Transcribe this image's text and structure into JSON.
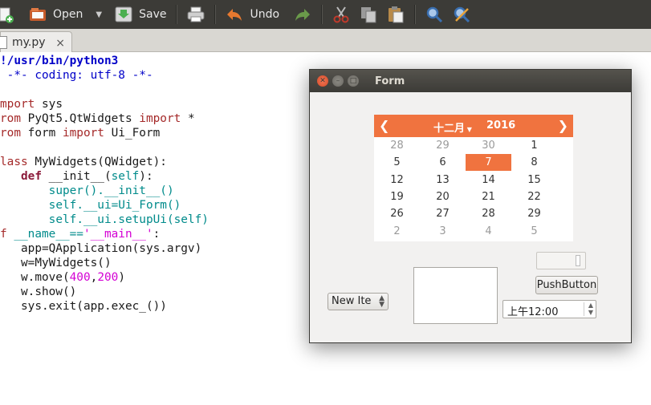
{
  "toolbar": {
    "open_label": "Open",
    "save_label": "Save",
    "undo_label": "Undo",
    "icons": [
      "new-document-icon",
      "open-folder-icon",
      "dropdown-arrow-icon",
      "save-icon",
      "print-icon",
      "undo-icon",
      "redo-icon",
      "cut-icon",
      "copy-icon",
      "paste-icon",
      "search-icon",
      "replace-icon"
    ]
  },
  "tabs": [
    {
      "label": "my.py",
      "close": "×"
    }
  ],
  "code_lines": [
    [
      {
        "t": "!/usr/bin/python3",
        "c": "c-dir"
      }
    ],
    [
      {
        "t": " -*- coding: utf-8 -*-",
        "c": "c-cm"
      }
    ],
    [],
    [
      {
        "t": "mport",
        "c": "c-kw"
      },
      {
        "t": " sys",
        "c": "c-tx"
      }
    ],
    [
      {
        "t": "rom",
        "c": "c-kw"
      },
      {
        "t": " PyQt5.QtWidgets ",
        "c": "c-tx"
      },
      {
        "t": "import",
        "c": "c-kw"
      },
      {
        "t": " *",
        "c": "c-tx"
      }
    ],
    [
      {
        "t": "rom",
        "c": "c-kw"
      },
      {
        "t": " form ",
        "c": "c-tx"
      },
      {
        "t": "import",
        "c": "c-kw"
      },
      {
        "t": " Ui_Form",
        "c": "c-tx"
      }
    ],
    [],
    [
      {
        "t": "lass",
        "c": "c-kw"
      },
      {
        "t": " MyWidgets(QWidget):",
        "c": "c-tx"
      }
    ],
    [
      {
        "t": "   ",
        "c": "c-tx"
      },
      {
        "t": "def",
        "c": "c-kw2"
      },
      {
        "t": " __init__(",
        "c": "c-tx"
      },
      {
        "t": "self",
        "c": "c-bi"
      },
      {
        "t": "):",
        "c": "c-tx"
      }
    ],
    [
      {
        "t": "       ",
        "c": "c-tx"
      },
      {
        "t": "super",
        "c": "c-bi"
      },
      {
        "t": "().__init__()",
        "c": "c-bi"
      }
    ],
    [
      {
        "t": "       ",
        "c": "c-tx"
      },
      {
        "t": "self",
        "c": "c-bi"
      },
      {
        "t": ".__ui=Ui_Form()",
        "c": "c-bi"
      }
    ],
    [
      {
        "t": "       ",
        "c": "c-tx"
      },
      {
        "t": "self",
        "c": "c-bi"
      },
      {
        "t": ".__ui.setupUi(",
        "c": "c-bi"
      },
      {
        "t": "self",
        "c": "c-bi"
      },
      {
        "t": ")",
        "c": "c-bi"
      }
    ],
    [
      {
        "t": "f",
        "c": "c-kw"
      },
      {
        "t": " __name__==",
        "c": "c-bi"
      },
      {
        "t": "'__main__'",
        "c": "c-str"
      },
      {
        "t": ":",
        "c": "c-tx"
      }
    ],
    [
      {
        "t": "   app=QApplication(sys.argv)",
        "c": "c-tx"
      }
    ],
    [
      {
        "t": "   w=MyWidgets()",
        "c": "c-tx"
      }
    ],
    [
      {
        "t": "   w.move(",
        "c": "c-tx"
      },
      {
        "t": "400",
        "c": "c-num"
      },
      {
        "t": ",",
        "c": "c-tx"
      },
      {
        "t": "200",
        "c": "c-num"
      },
      {
        "t": ")",
        "c": "c-tx"
      }
    ],
    [
      {
        "t": "   w.show()",
        "c": "c-tx"
      }
    ],
    [
      {
        "t": "   sys.exit(app.exec_())",
        "c": "c-tx"
      }
    ]
  ],
  "form": {
    "title": "Form",
    "calendar": {
      "month": "十二月",
      "year": "2016",
      "selected": "7",
      "weeks": [
        [
          {
            "d": "28",
            "dim": true
          },
          {
            "d": "29",
            "dim": true
          },
          {
            "d": "30",
            "dim": true
          },
          {
            "d": "1",
            "dim": false
          }
        ],
        [
          {
            "d": "5",
            "dim": false
          },
          {
            "d": "6",
            "dim": false
          },
          {
            "d": "7",
            "dim": false
          },
          {
            "d": "8",
            "dim": false
          }
        ],
        [
          {
            "d": "12",
            "dim": false
          },
          {
            "d": "13",
            "dim": false
          },
          {
            "d": "14",
            "dim": false
          },
          {
            "d": "15",
            "dim": false
          }
        ],
        [
          {
            "d": "19",
            "dim": false
          },
          {
            "d": "20",
            "dim": false
          },
          {
            "d": "21",
            "dim": false
          },
          {
            "d": "22",
            "dim": false
          }
        ],
        [
          {
            "d": "26",
            "dim": false
          },
          {
            "d": "27",
            "dim": false
          },
          {
            "d": "28",
            "dim": false
          },
          {
            "d": "29",
            "dim": false
          }
        ],
        [
          {
            "d": "2",
            "dim": true
          },
          {
            "d": "3",
            "dim": true
          },
          {
            "d": "4",
            "dim": true
          },
          {
            "d": "5",
            "dim": true
          }
        ]
      ]
    },
    "push_button": "PushButton",
    "combo_text": "New Ite",
    "time_value": "上午12:00"
  },
  "colors": {
    "accent": "#f0733f",
    "toolbar_bg": "#3c3b37"
  }
}
